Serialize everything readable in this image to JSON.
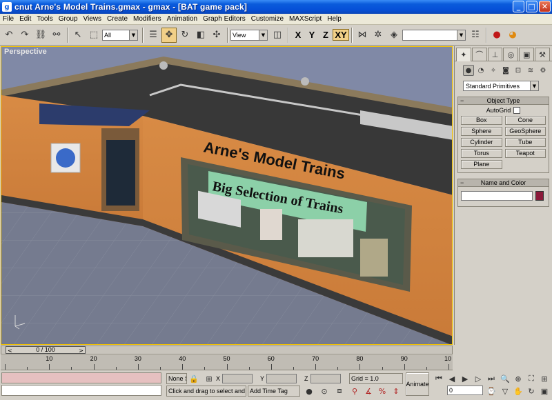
{
  "window": {
    "title": "cnut Arne's Model Trains.gmax - gmax - [BAT game pack]",
    "minimize": "_",
    "maximize": "□",
    "close": "✕"
  },
  "menu": [
    "File",
    "Edit",
    "Tools",
    "Group",
    "Views",
    "Create",
    "Modifiers",
    "Animation",
    "Graph Editors",
    "Customize",
    "MAXScript",
    "Help"
  ],
  "toolbar": {
    "selection_filter": "All",
    "ref_coord": "View",
    "axis_x": "X",
    "axis_y": "Y",
    "axis_z": "Z",
    "axis_xy": "XY",
    "named_selection": ""
  },
  "viewport": {
    "label": "Perspective",
    "sign_main": "Arne's Model Trains",
    "sign_sub": "Big Selection of Trains"
  },
  "command_panel": {
    "category": "Standard Primitives",
    "object_type_header": "Object Type",
    "autogrid_label": "AutoGrid",
    "primitives": [
      "Box",
      "Cone",
      "Sphere",
      "GeoSphere",
      "Cylinder",
      "Tube",
      "Torus",
      "Teapot",
      "Plane"
    ],
    "name_color_header": "Name and Color",
    "object_name": "",
    "object_color": "#8b1a3a"
  },
  "timeline": {
    "frame_display": "0 / 100",
    "prev": "<",
    "next": ">",
    "ticks": [
      "10",
      "20",
      "30",
      "40",
      "50",
      "60",
      "70",
      "80",
      "90",
      "10"
    ]
  },
  "status": {
    "selection": "None S",
    "x_label": "X",
    "y_label": "Y",
    "z_label": "Z",
    "x_value": "",
    "y_value": "",
    "z_value": "",
    "grid": "Grid = 1.0",
    "prompt": "Click and drag to select and m",
    "add_time_tag": "Add Time Tag",
    "animate": "Animate",
    "current_frame": "0"
  }
}
